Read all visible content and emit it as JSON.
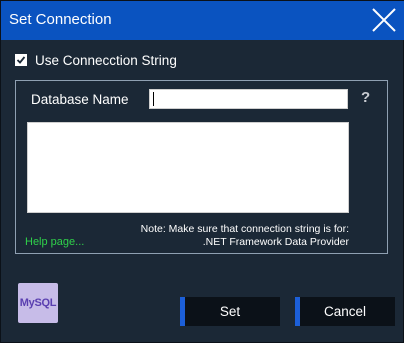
{
  "window": {
    "title": "Set Connection"
  },
  "options": {
    "use_connection_string_label": "Use Connecction String",
    "use_connection_string_checked": true
  },
  "form": {
    "database_name_label": "Database Name",
    "database_name_value": "",
    "help_icon": "?",
    "connection_string_value": "",
    "note_line1": "Note: Make sure that connection string is for:",
    "note_line2": ".NET Framework Data Provider",
    "help_link": "Help page..."
  },
  "footer": {
    "logo_text": "MySQL",
    "set_label": "Set",
    "cancel_label": "Cancel"
  },
  "colors": {
    "titlebar": "#0a53c0",
    "background": "#1b2836",
    "link": "#2fd24a",
    "button_accent": "#1c5fd8"
  }
}
